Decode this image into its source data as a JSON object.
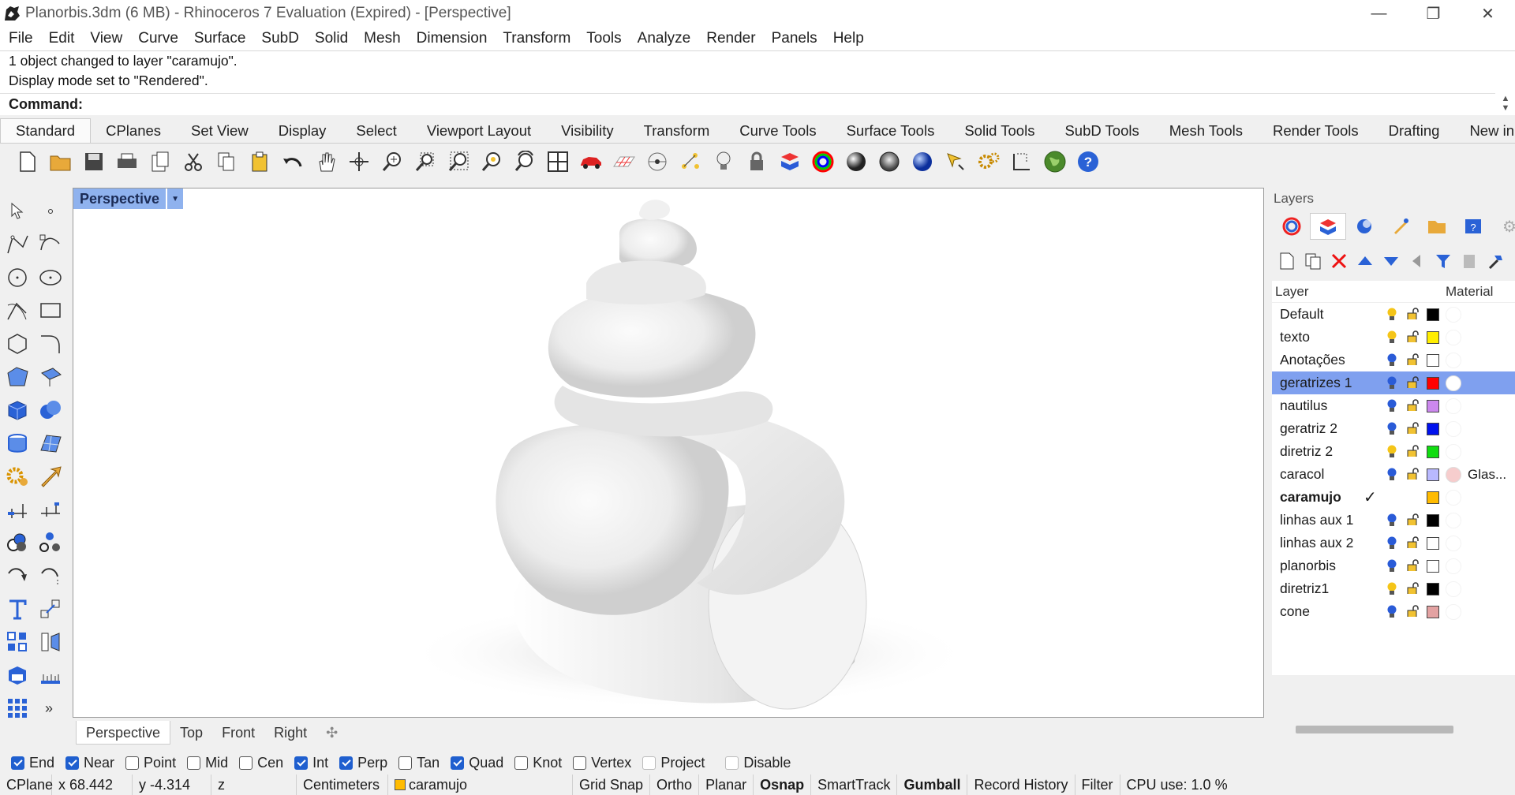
{
  "window": {
    "title": "Planorbis.3dm (6 MB) - Rhinoceros 7 Evaluation (Expired) - [Perspective]"
  },
  "menu": [
    "File",
    "Edit",
    "View",
    "Curve",
    "Surface",
    "SubD",
    "Solid",
    "Mesh",
    "Dimension",
    "Transform",
    "Tools",
    "Analyze",
    "Render",
    "Panels",
    "Help"
  ],
  "command": {
    "history": [
      "1 object changed to layer \"caramujo\".",
      "Display mode set to \"Rendered\"."
    ],
    "prompt": "Command:"
  },
  "toolbar_tabs": [
    "Standard",
    "CPlanes",
    "Set View",
    "Display",
    "Select",
    "Viewport Layout",
    "Visibility",
    "Transform",
    "Curve Tools",
    "Surface Tools",
    "Solid Tools",
    "SubD Tools",
    "Mesh Tools",
    "Render Tools",
    "Drafting",
    "New in"
  ],
  "viewport": {
    "name": "Perspective"
  },
  "view_tabs": [
    "Perspective",
    "Top",
    "Front",
    "Right"
  ],
  "layers_panel": {
    "title": "Layers",
    "col_layer": "Layer",
    "col_material": "Material",
    "layers": [
      {
        "name": "Default",
        "color": "#000000",
        "bulb": "#f5c518"
      },
      {
        "name": "texto",
        "color": "#ffee00",
        "bulb": "#f5c518"
      },
      {
        "name": "Anotações",
        "color": "#ffffff",
        "bulb": "#2a5bd7"
      },
      {
        "name": "geratrizes 1",
        "color": "#ff0000",
        "bulb": "#2a5bd7",
        "material": "#ffffff",
        "selected": true
      },
      {
        "name": "nautilus",
        "color": "#cc88ee",
        "bulb": "#2a5bd7"
      },
      {
        "name": "geratriz 2",
        "color": "#0011ee",
        "bulb": "#2a5bd7"
      },
      {
        "name": "diretriz 2",
        "color": "#11dd11",
        "bulb": "#f5c518"
      },
      {
        "name": "caracol",
        "color": "#b9b9ff",
        "bulb": "#2a5bd7",
        "material": "#f6cdcd",
        "material_name": "Glas..."
      },
      {
        "name": "caramujo",
        "color": "#ffbb00",
        "current": true
      },
      {
        "name": "linhas aux 1",
        "color": "#000000",
        "bulb": "#2a5bd7"
      },
      {
        "name": "linhas aux 2",
        "color": "#ffffff",
        "bulb": "#2a5bd7"
      },
      {
        "name": "planorbis",
        "color": "#ffffff",
        "bulb": "#2a5bd7"
      },
      {
        "name": "diretriz1",
        "color": "#000000",
        "bulb": "#f5c518"
      },
      {
        "name": "cone",
        "color": "#e3a2a2",
        "bulb": "#2a5bd7"
      }
    ]
  },
  "osnaps": [
    {
      "label": "End",
      "on": true
    },
    {
      "label": "Near",
      "on": true
    },
    {
      "label": "Point",
      "on": false
    },
    {
      "label": "Mid",
      "on": false
    },
    {
      "label": "Cen",
      "on": false
    },
    {
      "label": "Int",
      "on": true
    },
    {
      "label": "Perp",
      "on": true
    },
    {
      "label": "Tan",
      "on": false
    },
    {
      "label": "Quad",
      "on": true
    },
    {
      "label": "Knot",
      "on": false
    },
    {
      "label": "Vertex",
      "on": false
    },
    {
      "label": "Project",
      "on": false
    },
    {
      "label": "Disable",
      "on": false
    }
  ],
  "status": {
    "cplane": "CPlane",
    "x": "x 68.442",
    "y": "y -4.314",
    "z": "z",
    "units": "Centimeters",
    "layer": "caramujo",
    "layer_color": "#ffbb00",
    "grid_snap": "Grid Snap",
    "ortho": "Ortho",
    "planar": "Planar",
    "osnap": "Osnap",
    "smarttrack": "SmartTrack",
    "gumball": "Gumball",
    "record_history": "Record History",
    "filter": "Filter",
    "cpu": "CPU use: 1.0 %"
  }
}
